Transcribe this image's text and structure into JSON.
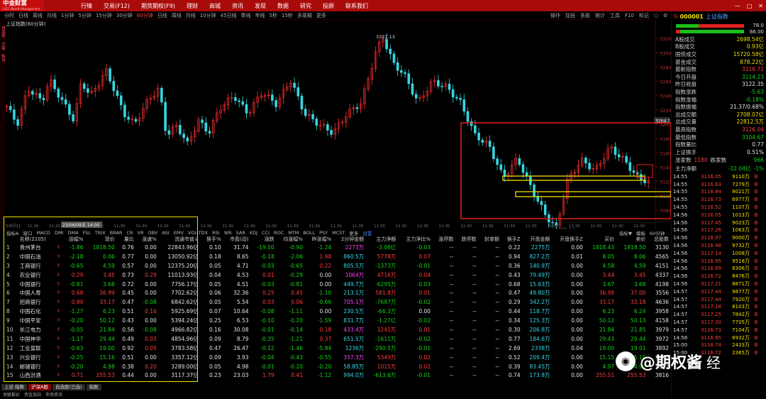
{
  "app": {
    "logo": "中金财富",
    "logo_sub": "CICC Wealth Management"
  },
  "menu": [
    "行情",
    "交易(F12)",
    "期货期权(F9)",
    "理财",
    "商城",
    "资讯",
    "发现",
    "数据",
    "研究",
    "投顾",
    "联系我们"
  ],
  "window_buttons": [
    "—",
    "□",
    "✕"
  ],
  "periods": [
    "分时",
    "日线",
    "周线",
    "月线",
    "1分钟",
    "5分钟",
    "15分钟",
    "30分钟",
    "60分钟",
    "日线",
    "周线",
    "月线",
    "10分钟",
    "45日线",
    "季线",
    "年线",
    "5秒",
    "15秒",
    "多周期",
    "更多"
  ],
  "period_active_index": 8,
  "right_tools": [
    "操作",
    "加自",
    "多股",
    "统计",
    "工具",
    "F10",
    "标记",
    "○",
    "⚙",
    "≡"
  ],
  "chart": {
    "title": "上证指数(60分钟)",
    "high_label": "3322.13",
    "low_label": "3053.04",
    "cursor_label": "3204.7",
    "date_label": "23/06/09五 14:00",
    "y_ticks": [
      "3320",
      "3300",
      "3280",
      "3260",
      "3240",
      "3220",
      "3200",
      "3180",
      "3160",
      "3140",
      "3120",
      "3100",
      "3080"
    ],
    "x_ticks": [
      "5/8日11",
      "11:30",
      "11:30",
      "11:30",
      "11:30",
      "11:30",
      "11:30",
      "11:30",
      "11:30",
      "11:30",
      "11:30",
      "11:30",
      "11:30",
      "11:30",
      "11:30",
      "11:30",
      "11:30",
      "11:30",
      "11:30",
      "11:30",
      "11:30",
      "11:30",
      "11:30",
      "11:30",
      "11:30",
      "11:30",
      "11:30",
      "11:30",
      "11:30",
      "11:30"
    ]
  },
  "left_sidebar": [
    "自选股",
    "大盘",
    "板块"
  ],
  "indicators": [
    "指标A",
    "窗口",
    "MACD",
    "DMI",
    "DMA",
    "FSL",
    "TRIX",
    "BRAR",
    "CR",
    "VR",
    "OBV",
    "ASI",
    "EMV",
    "VOL-TDX",
    "RSI",
    "WR",
    "SAR",
    "KDJ",
    "CCI",
    "ROC",
    "MTM",
    "BOLL",
    "PSY",
    "MCST",
    "更多",
    "设置"
  ],
  "indicator_right": [
    "指标▼",
    "模板",
    "60分钟"
  ],
  "table": {
    "headers": [
      "名称(2105)",
      "",
      "涨幅%",
      "现价",
      "量比",
      "涨速%",
      "流通市值↓",
      "换手%",
      "市盈(动)",
      "涨跌",
      "均涨幅%",
      "昨涨幅%",
      "2分钟金额",
      "主力净额",
      "主力净比%",
      "涨停数",
      "跌停数",
      "封单额",
      "换手Z",
      "开盘金额",
      "开盘换手Z",
      "买价",
      "卖价",
      "总股数"
    ],
    "rows": [
      [
        "1",
        "贵州茅台",
        "R",
        "-1.86",
        "1818.50",
        "0.76",
        "0.00",
        "22843.96亿",
        "0.10",
        "31.74",
        "-19.50",
        "-0.90",
        "-1.24",
        "2273万",
        "-3.08亿",
        "-0.03",
        "--",
        "--",
        "--",
        "0.22",
        "2275万",
        "0.00",
        "1818.43",
        "1818.50",
        "3130"
      ],
      [
        "2",
        "中国石油",
        "R",
        "-2.18",
        "0.06",
        "0.77",
        "0.00",
        "13050.92亿",
        "0.18",
        "8.65",
        "-0.18",
        "-2.06",
        "1.98",
        "860.5万",
        "5778万",
        "0.07",
        "--",
        "--",
        "--",
        "0.94",
        "827.2万",
        "0.01",
        "8.05",
        "8.06",
        "4565"
      ],
      [
        "3",
        "工商银行",
        "R",
        "-0.65",
        "4.59",
        "0.57",
        "0.00",
        "12375.20亿",
        "0.05",
        "4.71",
        "-0.03",
        "-0.65",
        "0.22",
        "805.5万",
        "-1373万",
        "-0.01",
        "--",
        "--",
        "--",
        "0.36",
        "140.9万",
        "0.00",
        "4.58",
        "4.59",
        "4151"
      ],
      [
        "4",
        "农业银行",
        "R",
        "0.29",
        "3.45",
        "0.73",
        "0.29",
        "11013.93亿",
        "0.04",
        "4.53",
        "0.01",
        "-0.29",
        "0.00",
        "1064万",
        "4716万",
        "0.04",
        "--",
        "--",
        "--",
        "0.43",
        "79.49万",
        "0.00",
        "3.44",
        "3.45",
        "4337"
      ],
      [
        "5",
        "中国银行",
        "R",
        "-0.81",
        "3.68",
        "0.72",
        "0.00",
        "7756.17亿",
        "0.05",
        "4.51",
        "-0.03",
        "-0.81",
        "0.00",
        "449.7万",
        "-6295万",
        "-0.03",
        "--",
        "--",
        "--",
        "0.68",
        "15.63万",
        "0.00",
        "3.67",
        "3.68",
        "4198"
      ],
      [
        "6",
        "中国人寿",
        "R",
        "0.68",
        "36.99",
        "0.45",
        "0.00",
        "7702.62亿",
        "0.06",
        "32.36",
        "0.25",
        "0.41",
        "-1.10",
        "213.1万",
        "581.8万",
        "0.01",
        "--",
        "--",
        "--",
        "0.47",
        "49.80万",
        "0.00",
        "36.99",
        "37.00",
        "3556"
      ],
      [
        "7",
        "招商银行",
        "R",
        "0.89",
        "33.17",
        "0.47",
        "-0.08",
        "6842.62亿",
        "0.05",
        "5.54",
        "0.03",
        "0.06",
        "-0.66",
        "705.1万",
        "-7687万",
        "-0.02",
        "--",
        "--",
        "--",
        "0.29",
        "342.2万",
        "0.00",
        "33.17",
        "33.18",
        "4636"
      ],
      [
        "8",
        "中国石化",
        "R",
        "-1.27",
        "6.23",
        "0.51",
        "0.16",
        "5925.69亿",
        "0.07",
        "10.64",
        "-0.08",
        "-1.11",
        "0.00",
        "230.5万",
        "-66.3万",
        "0.00",
        "--",
        "--",
        "--",
        "0.44",
        "118.7万",
        "0.00",
        "6.23",
        "6.24",
        "3958"
      ],
      [
        "9",
        "中国平安",
        "R",
        "-0.20",
        "50.12",
        "0.43",
        "0.00",
        "5394.24亿",
        "0.25",
        "6.53",
        "-0.10",
        "-0.20",
        "-1.59",
        "831.7万",
        "-1.27亿",
        "-0.02",
        "--",
        "--",
        "--",
        "0.34",
        "125.3万",
        "0.00",
        "50.12",
        "50.13",
        "4158"
      ],
      [
        "10",
        "长江电力",
        "R",
        "-0.05",
        "21.84",
        "0.56",
        "-0.08",
        "4966.82亿",
        "0.16",
        "30.08",
        "-0.01",
        "-0.14",
        "0.18",
        "433.4万",
        "1241万",
        "0.01",
        "--",
        "--",
        "--",
        "0.30",
        "206.8万",
        "0.00",
        "21.84",
        "21.85",
        "3979"
      ],
      [
        "11",
        "中国神华",
        "R",
        "-1.17",
        "29.44",
        "0.49",
        "0.03",
        "4854.96亿",
        "0.09",
        "8.79",
        "-0.35",
        "-1.21",
        "0.37",
        "651.5万",
        "-1611万",
        "-0.02",
        "--",
        "--",
        "--",
        "0.77",
        "184.6万",
        "0.00",
        "29.43",
        "29.44",
        "3972"
      ],
      [
        "12",
        "工业富联",
        "R",
        "-0.63",
        "19.00",
        "0.92",
        "0.05",
        "3783.58亿",
        "0.47",
        "26.47",
        "-0.12",
        "-1.46",
        "-5.84",
        "1236万",
        "-290.5万",
        "-0.01",
        "--",
        "--",
        "--",
        "2.69",
        "2338万",
        "0.04",
        "19.00",
        "19.01",
        "3892"
      ],
      [
        "13",
        "兴业银行",
        "R",
        "-0.25",
        "15.16",
        "0.51",
        "0.00",
        "3357.12亿",
        "0.09",
        "3.93",
        "-0.04",
        "-0.43",
        "-0.55",
        "357.3万",
        "5349万",
        "0.02",
        "--",
        "--",
        "--",
        "0.52",
        "209.4万",
        "0.00",
        "15.15",
        "15.16",
        "3852"
      ],
      [
        "14",
        "邮储银行",
        "R",
        "-0.20",
        "4.98",
        "0.38",
        "0.20",
        "3289.00亿",
        "0.05",
        "4.98",
        "-0.01",
        "-0.20",
        "-0.20",
        "58.85万",
        "1015万",
        "0.02",
        "--",
        "--",
        "--",
        "0.39",
        "83.45万",
        "0.00",
        "4.97",
        "4.98",
        "3803"
      ],
      [
        "15",
        "山西汾酒",
        "R",
        "0.71",
        "255.53",
        "0.44",
        "0.00",
        "3117.37亿",
        "0.23",
        "23.03",
        "1.79",
        "0.41",
        "-1.12",
        "994.0万",
        "-613.6万",
        "-0.01",
        "--",
        "--",
        "--",
        "0.74",
        "173.8万",
        "0.00",
        "255.51",
        "255.53",
        "3816"
      ]
    ]
  },
  "bottom": {
    "tabs": [
      "上证·指数",
      "沪深A股",
      "自选股(已选)",
      "指数"
    ],
    "links": [
      "关联报价",
      "资金流向",
      "市场资讯"
    ]
  },
  "right_panel": {
    "badge": "G",
    "code": "000001",
    "title": "上证指数",
    "bar_values": [
      "78.0",
      "66.00"
    ],
    "stats": [
      [
        "A股成交",
        "2698.54亿",
        "yel"
      ],
      [
        "B股成交",
        "0.93亿",
        "yel"
      ],
      [
        "国债成交",
        "15720.58亿",
        "yel"
      ],
      [
        "基金成交",
        "878.22亿",
        "yel"
      ],
      [
        "最新指数",
        "3116.72",
        "red"
      ],
      [
        "今日开盘",
        "3114.23",
        "grn"
      ],
      [
        "昨日收盘",
        "3122.35",
        "wht"
      ],
      [
        "指数涨跌",
        "-5.63",
        "grn"
      ],
      [
        "指数涨幅",
        "-0.18%",
        "grn"
      ],
      [
        "指数振幅",
        "21.37/0.68%",
        "wht"
      ],
      [
        "总成交额",
        "2708.07亿",
        "yel"
      ],
      [
        "总成交量",
        "22812.5万",
        "yel"
      ],
      [
        "最高指数",
        "3126.04",
        "red"
      ],
      [
        "最低指数",
        "3104.67",
        "grn"
      ],
      [
        "指数量比",
        "0.77",
        "wht"
      ],
      [
        "上证换手",
        "0.51%",
        "wht"
      ]
    ],
    "updown": {
      "up_label": "涨家数",
      "up": "1180",
      "down_label": "跌家数",
      "down": "966"
    },
    "net": {
      "label": "主力净额",
      "value": "-22.04亿",
      "pct": "-1%"
    },
    "ticks": [
      [
        "14:55",
        "3116.05",
        "9110万",
        "B"
      ],
      [
        "14:55",
        "3116.63",
        "7279万",
        "B"
      ],
      [
        "14:55",
        "3116.84",
        "8021万",
        "B"
      ],
      [
        "14:55",
        "3116.73",
        "6977万",
        "B"
      ],
      [
        "14:55",
        "3116.52",
        "1107万",
        "B"
      ],
      [
        "14:56",
        "3116.05",
        "1013万",
        "B"
      ],
      [
        "14:56",
        "3117.45",
        "9023万",
        "B"
      ],
      [
        "14:56",
        "3117.26",
        "1063万",
        "B"
      ],
      [
        "14:56",
        "3116.97",
        "9000万",
        "B"
      ],
      [
        "14:56",
        "3116.98",
        "9732万",
        "B"
      ],
      [
        "14:56",
        "3117.14",
        "1008万",
        "B"
      ],
      [
        "14:56",
        "3116.95",
        "9518万",
        "B"
      ],
      [
        "14:56",
        "3116.89",
        "8306万",
        "B"
      ],
      [
        "14:56",
        "3116.72",
        "8476万",
        "B"
      ],
      [
        "14:56",
        "3117.21",
        "8871万",
        "B"
      ],
      [
        "14:57",
        "3117.44",
        "9877万",
        "B"
      ],
      [
        "14:57",
        "3117.44",
        "7920万",
        "B"
      ],
      [
        "14:57",
        "3117.18",
        "8103万",
        "B"
      ],
      [
        "14:57",
        "3117.25",
        "7842万",
        "B"
      ],
      [
        "14:57",
        "3117.20",
        "7705万",
        "B"
      ],
      [
        "14:57",
        "3116.73",
        "7104万",
        "B"
      ],
      [
        "14:58",
        "3116.85",
        "6932万",
        "B"
      ],
      [
        "15:00",
        "3116.74",
        "2433万",
        "B"
      ],
      [
        "15:00",
        "3116.72",
        "2365万",
        "B"
      ]
    ]
  },
  "watermark": {
    "text": "@期权酱",
    "suffix": "经"
  }
}
